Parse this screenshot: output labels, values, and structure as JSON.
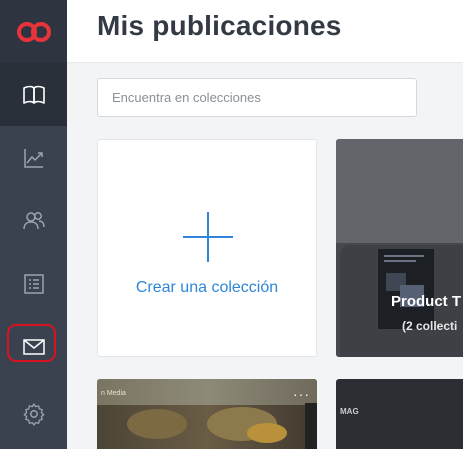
{
  "page": {
    "title": "Mis publicaciones"
  },
  "search": {
    "placeholder": "Encuentra en colecciones"
  },
  "sidebar": {
    "logo": "issuu-logo-icon",
    "items": [
      {
        "icon": "book-icon",
        "active": true
      },
      {
        "icon": "stats-chart-icon",
        "active": false
      },
      {
        "icon": "people-icon",
        "active": false
      },
      {
        "icon": "list-icon",
        "active": false
      },
      {
        "icon": "envelope-icon",
        "active": false,
        "highlighted": true
      },
      {
        "icon": "gear-icon",
        "active": false
      }
    ]
  },
  "create_card": {
    "label": "Crear una colección"
  },
  "collection_card": {
    "title": "Product T",
    "subtitle": "(2 collecti"
  },
  "publications": [
    {
      "label": "n Media",
      "menu": "···"
    },
    {
      "label": "MAG"
    }
  ],
  "colors": {
    "sidebar_bg": "#3a4250",
    "accent_blue": "#2f86d6",
    "highlight_red": "#d9121f",
    "logo_red": "#e8333b"
  }
}
